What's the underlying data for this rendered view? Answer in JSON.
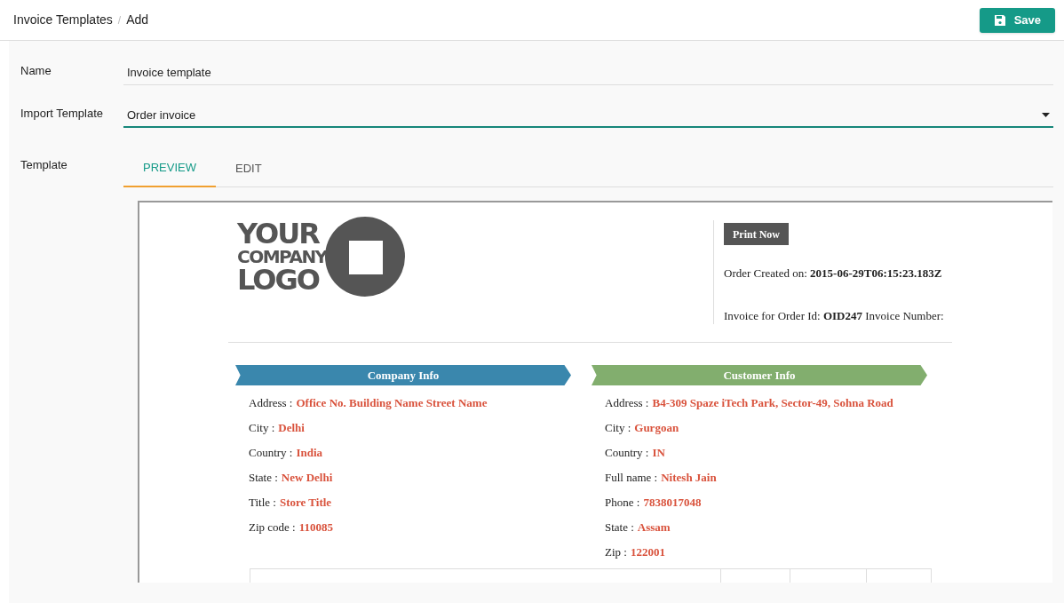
{
  "breadcrumb": [
    {
      "label": "Invoice Templates"
    },
    {
      "label": "Add"
    }
  ],
  "breadcrumb_separator": "/",
  "save_button": {
    "label": "Save"
  },
  "fields": [
    {
      "label": "Name",
      "kind": "text",
      "value": "Invoice template"
    },
    {
      "label": "Import Template",
      "kind": "select",
      "value": "Order invoice"
    }
  ],
  "template": {
    "label": "Template",
    "tabs": [
      {
        "label": "PREVIEW",
        "selected": true
      },
      {
        "label": "EDIT",
        "selected": false
      }
    ],
    "preview": {
      "logo": [
        "YOUR",
        "COMPANY",
        "LOGO"
      ],
      "print_button": "Print Now",
      "order_created": "Order Created on: **2015-06-29T06:15:23.183Z**",
      "invoice_line": "Invoice for Order Id: **OID247** Invoice Number:",
      "sections": [
        {
          "title": "Company Info",
          "color": "#3a87ad",
          "rows": [
            {
              "label": "Address :",
              "value": "Office No. Building Name Street Name"
            },
            {
              "label": "City :",
              "value": "Delhi"
            },
            {
              "label": "Country :",
              "value": "India"
            },
            {
              "label": "State :",
              "value": "New Delhi"
            },
            {
              "label": "Title :",
              "value": "Store Title"
            },
            {
              "label": "Zip code :",
              "value": "110085"
            }
          ]
        },
        {
          "title": "Customer Info",
          "color": "#82ae6e",
          "rows": [
            {
              "label": "Address :",
              "value": "B4-309 Spaze iTech Park, Sector-49, Sohna Road"
            },
            {
              "label": "City :",
              "value": "Gurgoan"
            },
            {
              "label": "Country :",
              "value": "IN"
            },
            {
              "label": "Full name :",
              "value": "Nitesh Jain"
            },
            {
              "label": "Phone :",
              "value": "7838017048"
            },
            {
              "label": "State :",
              "value": "Assam"
            },
            {
              "label": "Zip :",
              "value": "122001"
            }
          ]
        }
      ]
    }
  }
}
